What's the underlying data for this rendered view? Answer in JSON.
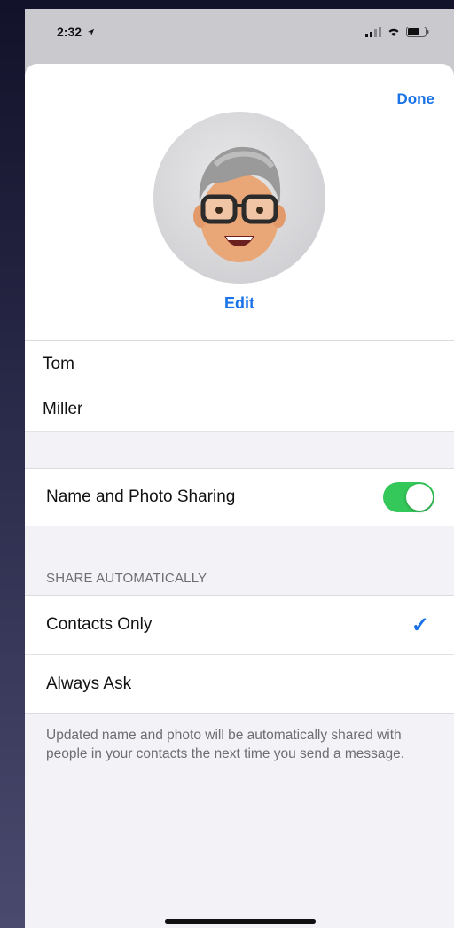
{
  "status_bar": {
    "time": "2:32",
    "location_icon": "location-arrow-icon",
    "signal_icon": "cellular-signal-icon",
    "wifi_icon": "wifi-icon",
    "battery_icon": "battery-icon"
  },
  "header": {
    "done_label": "Done",
    "avatar_icon": "memoji-avatar-icon",
    "edit_label": "Edit"
  },
  "name_fields": {
    "first_name": "Tom",
    "last_name": "Miller"
  },
  "sharing": {
    "label": "Name and Photo Sharing",
    "enabled": true,
    "accent_color": "#34c759"
  },
  "share_automatically": {
    "section_title": "SHARE AUTOMATICALLY",
    "options": [
      {
        "label": "Contacts Only",
        "selected": true
      },
      {
        "label": "Always Ask",
        "selected": false
      }
    ],
    "checkmark_icon": "checkmark-icon",
    "footer_text": "Updated name and photo will be automatically shared with people in your contacts the next time you send a message."
  },
  "colors": {
    "tint": "#1a73e8",
    "background": "#f2f2f7"
  }
}
